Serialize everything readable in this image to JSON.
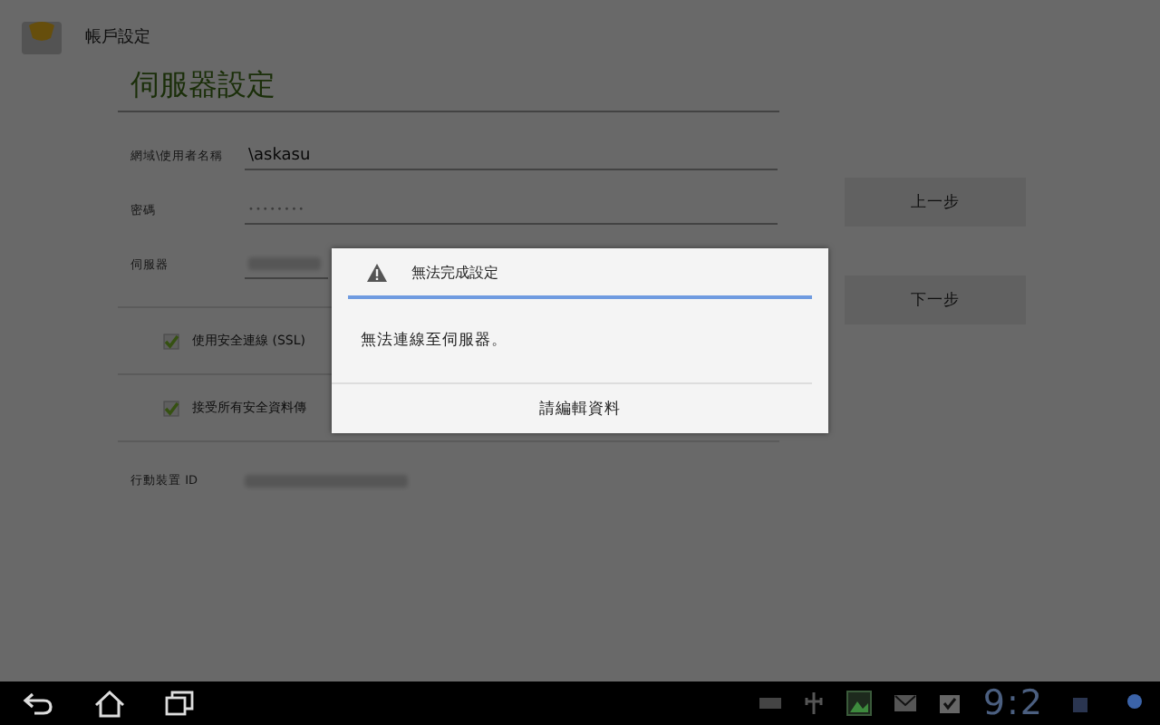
{
  "action_bar": {
    "title": "帳戶設定"
  },
  "section_title": "伺服器設定",
  "fields": [
    {
      "kind": "text",
      "label": "網域\\使用者名稱",
      "value": "\\askasu"
    },
    {
      "kind": "password",
      "label": "密碼",
      "value": "••••••••"
    },
    {
      "kind": "obscured",
      "label": "伺服器"
    }
  ],
  "checkboxes": [
    {
      "label": "使用安全連線 (SSL)",
      "checked": true
    },
    {
      "label": "接受所有安全資料傳",
      "checked": true
    }
  ],
  "device_id": {
    "label": "行動裝置 ID"
  },
  "buttons": [
    "上一步",
    "下一步"
  ],
  "dialog": {
    "title": "無法完成設定",
    "message": "無法連線至伺服器。",
    "button": "請編輯資料"
  },
  "nav_bar": {
    "time": "9:2"
  }
}
